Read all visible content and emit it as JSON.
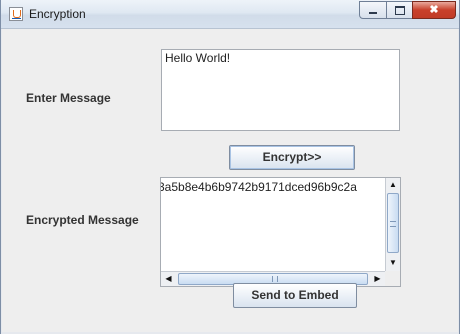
{
  "window": {
    "title": "Encryption",
    "icon": "java-icon",
    "controls": {
      "minimize": "minimize-icon",
      "maximize": "maximize-icon",
      "close": "✖"
    }
  },
  "form": {
    "message_label": "Enter Message",
    "message_value": "Hello World!",
    "encrypt_button": "Encrypt>>",
    "encrypted_label": "Encrypted Message",
    "encrypted_value": "3a5b8e4b6b9742b9171dced96b9c2a",
    "send_button": "Send to Embed"
  },
  "scrollbars": {
    "up_arrow": "▲",
    "down_arrow": "▼",
    "left_arrow": "◀",
    "right_arrow": "▶"
  }
}
